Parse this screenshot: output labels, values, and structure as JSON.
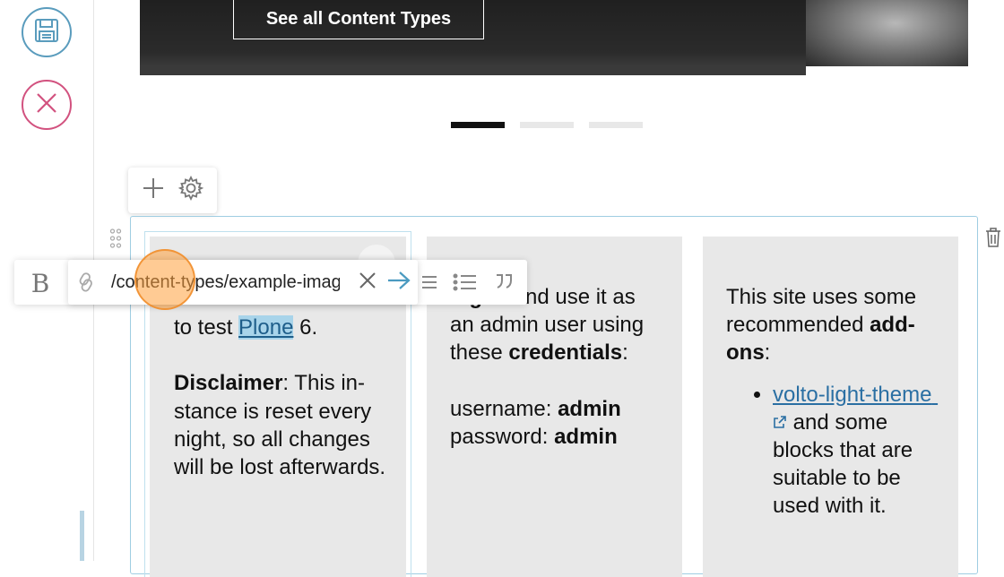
{
  "toolbar": {
    "save_icon": "floppy-disk-icon",
    "cancel_icon": "close-circle-icon"
  },
  "hero": {
    "button_label": "See all Content Types",
    "slide_count": 3,
    "active_slide": 1
  },
  "block_add_popup": {
    "add_icon": "plus-icon",
    "settings_icon": "gear-icon"
  },
  "format_toolbar": {
    "bold_label": "B",
    "link_input_value": "/content-types/example-image",
    "icons": [
      "link-icon",
      "clear-icon",
      "submit-arrow-icon",
      "align-icon",
      "bullet-list-icon",
      "blockquote-icon"
    ]
  },
  "columns": [
    {
      "line1_link": "Plone",
      "line1_pre": "to test ",
      "line1_post": " 6.",
      "disclaimer_label": "Disclaimer",
      "disclaimer_text": ": This in-stance is reset every night, so all changes will be lost afterwards."
    },
    {
      "login_bold": "log in",
      "login_after": " and use it as an admin user using these ",
      "credentials_bold": "credentials",
      "credentials_after": ":",
      "username_label": "username: ",
      "username_value": "admin",
      "password_label": "password: ",
      "password_value": "admin"
    },
    {
      "intro": "This site uses some recommended ",
      "addons_bold": "add-ons",
      "addons_after": ":",
      "item_link": "volto-light-theme",
      "item_after": " and some blocks that are suitable to be used with it."
    }
  ]
}
